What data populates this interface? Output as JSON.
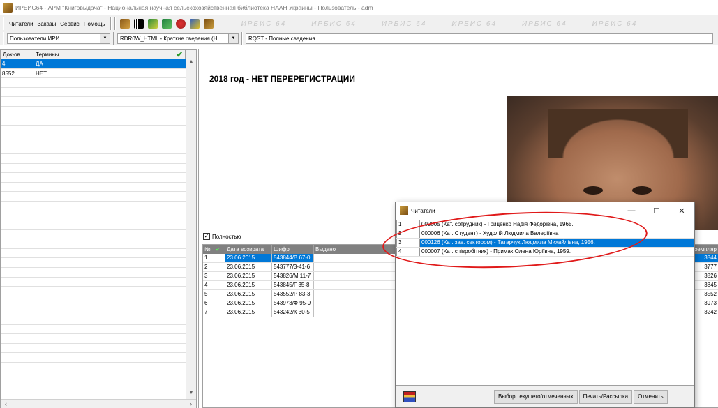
{
  "window": {
    "title": "ИРБИС64 - АРМ \"Книговыдача\" - Национальная научная сельскохозяйственная библиотека НААН Украины - Пользователь - adm"
  },
  "menu": {
    "items": [
      "Читатели",
      "Заказы",
      "Сервис",
      "Помощь"
    ]
  },
  "toolbar": {
    "watermark": "ИРБИС 64",
    "icons": [
      "reader-icon",
      "barcode-icon",
      "catalog-icon",
      "table-icon",
      "settings-icon",
      "flag-icon",
      "books-icon"
    ]
  },
  "combos": {
    "database": "Пользователи ИРИ",
    "format": "RDR0W_HTML - Краткие сведения (Н",
    "query": "RQST - Полные сведения"
  },
  "left_grid": {
    "headers": [
      "Док-ов",
      "Термины"
    ],
    "rows": [
      {
        "count": "4",
        "term": "ДА"
      },
      {
        "count": "8552",
        "term": "НЕТ"
      }
    ]
  },
  "document": {
    "title": "2018 год - НЕТ ПЕРЕРЕГИСТРАЦИИ"
  },
  "loans": {
    "full_label": "Полностью",
    "headers": [
      "№",
      "",
      "Дата возврата",
      "Шифр",
      "Выдано",
      "Экземпляр"
    ],
    "rows": [
      {
        "n": "1",
        "date": "23.06.2015",
        "code": "543844/В 67-0",
        "copy": "3844"
      },
      {
        "n": "2",
        "date": "23.06.2015",
        "code": "543777/3-41-6",
        "copy": "3777"
      },
      {
        "n": "3",
        "date": "23.06.2015",
        "code": "543826/М 11-7",
        "copy": "3826"
      },
      {
        "n": "4",
        "date": "23.06.2015",
        "code": "543845/Г 35-8",
        "copy": "3845"
      },
      {
        "n": "5",
        "date": "23.06.2015",
        "code": "543552/Р 83-3",
        "copy": "3552"
      },
      {
        "n": "6",
        "date": "23.06.2015",
        "code": "543973/Ф 95-9",
        "copy": "3973"
      },
      {
        "n": "7",
        "date": "23.06.2015",
        "code": "543242/К 30-5",
        "copy": "3242"
      }
    ]
  },
  "readers_dialog": {
    "title": "Читатели",
    "rows": [
      {
        "n": "1",
        "text": "000005 (Кат. сотрудник) - Гриценко Надія Федорівна, 1965."
      },
      {
        "n": "2",
        "text": "000006 (Кат. Студент) - Худолій Людмила Валеріївна"
      },
      {
        "n": "3",
        "text": "000126 (Кат. зав. сектором) - Татарчук Людмила Михайлівна, 1956."
      },
      {
        "n": "4",
        "text": "000007 (Кат. співробітник) - Примак Олена Юріївна, 1959."
      }
    ],
    "buttons": {
      "select": "Выбор текущего/отмеченных",
      "print": "Печать/Рассылка",
      "cancel": "Отменить"
    }
  },
  "colors": {
    "selection": "#0078d7",
    "annotation": "#e01a1a"
  }
}
